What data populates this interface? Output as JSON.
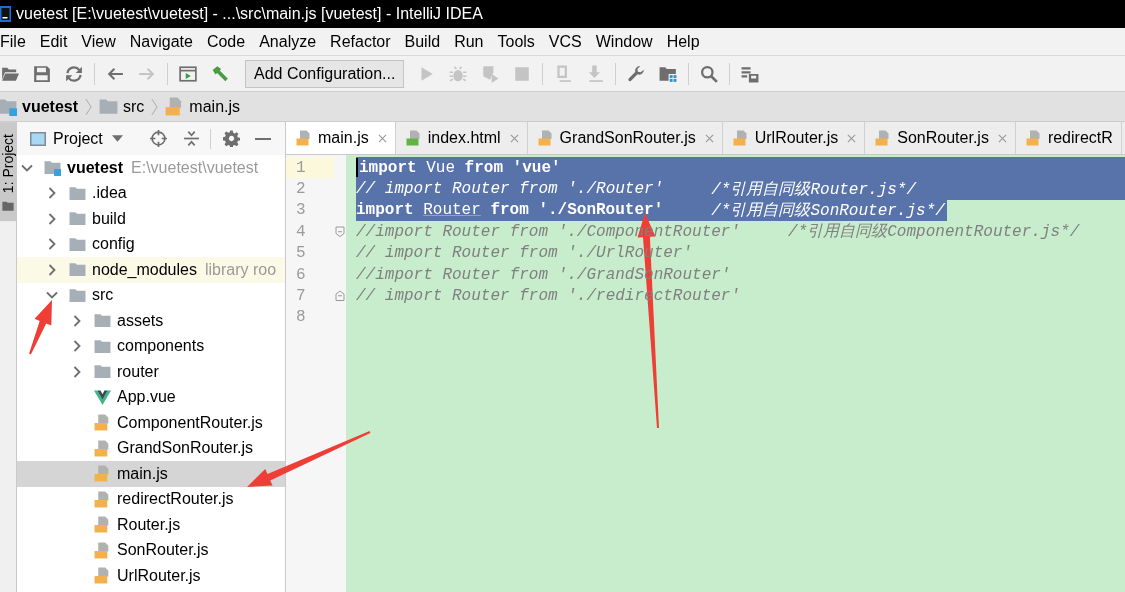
{
  "window": {
    "title": "vuetest [E:\\vuetest\\vuetest] - ...\\src\\main.js [vuetest] - IntelliJ IDEA"
  },
  "menu": [
    "File",
    "Edit",
    "View",
    "Navigate",
    "Code",
    "Analyze",
    "Refactor",
    "Build",
    "Run",
    "Tools",
    "VCS",
    "Window",
    "Help"
  ],
  "toolbar_groups": [
    [
      {
        "kind": "open",
        "disabled": false
      },
      {
        "kind": "save",
        "disabled": false
      },
      {
        "kind": "sync",
        "disabled": false
      }
    ],
    [
      {
        "kind": "back",
        "disabled": false
      },
      {
        "kind": "forward",
        "disabled": true
      }
    ],
    [
      {
        "kind": "terminal",
        "disabled": false
      },
      {
        "kind": "build",
        "disabled": false
      },
      {
        "kind": "combo",
        "label": "Add Configuration..."
      },
      {
        "kind": "run",
        "disabled": true
      },
      {
        "kind": "debug",
        "disabled": true
      },
      {
        "kind": "coverage",
        "disabled": true
      },
      {
        "kind": "stop",
        "disabled": true
      }
    ],
    [
      {
        "kind": "device",
        "disabled": true
      },
      {
        "kind": "download",
        "disabled": true
      }
    ],
    [
      {
        "kind": "wrench",
        "disabled": false
      },
      {
        "kind": "structure",
        "disabled": false
      }
    ],
    [
      {
        "kind": "search",
        "disabled": false
      }
    ],
    [
      {
        "kind": "layout",
        "disabled": false
      }
    ]
  ],
  "breadcrumbs": [
    {
      "kind": "module",
      "label": "vuetest"
    },
    {
      "kind": "folder",
      "label": "src"
    },
    {
      "kind": "js",
      "label": "main.js"
    }
  ],
  "tool_strip": [
    {
      "label": "1: Project",
      "selected": true
    }
  ],
  "project_panel": {
    "title": "Project",
    "tree": [
      {
        "kind": "module",
        "label": "vuetest",
        "note": "E:\\vuetest\\vuetest",
        "expanded": true,
        "selected": false,
        "children": [
          {
            "kind": "folder",
            "label": ".idea",
            "expanded": false,
            "selected": false
          },
          {
            "kind": "folder",
            "label": "build",
            "expanded": false,
            "selected": false
          },
          {
            "kind": "folder",
            "label": "config",
            "expanded": false,
            "selected": false
          },
          {
            "kind": "library",
            "label": "node_modules",
            "note": "library roo",
            "expanded": false,
            "selected": false
          },
          {
            "kind": "folder",
            "label": "src",
            "expanded": true,
            "selected": false,
            "children": [
              {
                "kind": "folder",
                "label": "assets",
                "expanded": false,
                "selected": false
              },
              {
                "kind": "folder",
                "label": "components",
                "expanded": false,
                "selected": false
              },
              {
                "kind": "folder",
                "label": "router",
                "expanded": false,
                "selected": false
              },
              {
                "kind": "vue",
                "label": "App.vue",
                "selected": false
              },
              {
                "kind": "js",
                "label": "ComponentRouter.js",
                "selected": false
              },
              {
                "kind": "js",
                "label": "GrandSonRouter.js",
                "selected": false
              },
              {
                "kind": "js",
                "label": "main.js",
                "selected": true
              },
              {
                "kind": "js",
                "label": "redirectRouter.js",
                "selected": false
              },
              {
                "kind": "js",
                "label": "Router.js",
                "selected": false
              },
              {
                "kind": "js",
                "label": "SonRouter.js",
                "selected": false
              },
              {
                "kind": "js",
                "label": "UrlRouter.js",
                "selected": false
              }
            ]
          }
        ]
      }
    ]
  },
  "editor": {
    "tabs": [
      {
        "label": "main.js",
        "kind": "js",
        "selected": true,
        "closable": true
      },
      {
        "label": "index.html",
        "kind": "html",
        "selected": false,
        "closable": true
      },
      {
        "label": "GrandSonRouter.js",
        "kind": "js",
        "selected": false,
        "closable": true
      },
      {
        "label": "UrlRouter.js",
        "kind": "js",
        "selected": false,
        "closable": true
      },
      {
        "label": "SonRouter.js",
        "kind": "js",
        "selected": false,
        "closable": true
      },
      {
        "label": "redirectR",
        "kind": "js",
        "selected": false,
        "closable": false
      }
    ],
    "lines": [
      {
        "number": "1",
        "current": true,
        "selected": true,
        "eol_selected": true,
        "tokens": [
          {
            "kind": "keyword",
            "text": "import"
          },
          {
            "kind": "plain",
            "text": "Vue"
          },
          {
            "kind": "keyword",
            "text": "from"
          },
          {
            "kind": "string",
            "text": "'vue'"
          }
        ]
      },
      {
        "number": "2",
        "current": false,
        "selected": true,
        "eol_selected": true,
        "tokens": [
          {
            "kind": "comment",
            "text": "// import Router from './Router'"
          },
          {
            "kind": "comment",
            "text": "/*引用自同级Router.js*/"
          }
        ]
      },
      {
        "number": "3",
        "current": false,
        "selected": true,
        "eol_selected": false,
        "tokens": [
          {
            "kind": "keyword",
            "text": "import"
          },
          {
            "kind": "unused",
            "text": "Router"
          },
          {
            "kind": "keyword",
            "text": "from"
          },
          {
            "kind": "string",
            "text": "'./SonRouter'"
          },
          {
            "kind": "comment",
            "text": "/*引用自同级SonRouter.js*/"
          }
        ]
      },
      {
        "number": "4",
        "current": false,
        "selected": false,
        "fold_start": true,
        "tokens": [
          {
            "kind": "comment",
            "text": "//import Router from './ComponentRouter'"
          },
          {
            "kind": "comment",
            "text": "/*引用自同级ComponentRouter.js*/"
          }
        ]
      },
      {
        "number": "5",
        "current": false,
        "selected": false,
        "tokens": [
          {
            "kind": "comment",
            "text": "// import Router from './UrlRouter'"
          }
        ]
      },
      {
        "number": "6",
        "current": false,
        "selected": false,
        "tokens": [
          {
            "kind": "comment",
            "text": "//import Router from './GrandSonRouter'"
          }
        ]
      },
      {
        "number": "7",
        "current": false,
        "selected": false,
        "fold_end": true,
        "tokens": [
          {
            "kind": "comment",
            "text": "// import Router from './redirectRouter'"
          }
        ]
      },
      {
        "number": "8",
        "current": false,
        "selected": false
      }
    ]
  }
}
